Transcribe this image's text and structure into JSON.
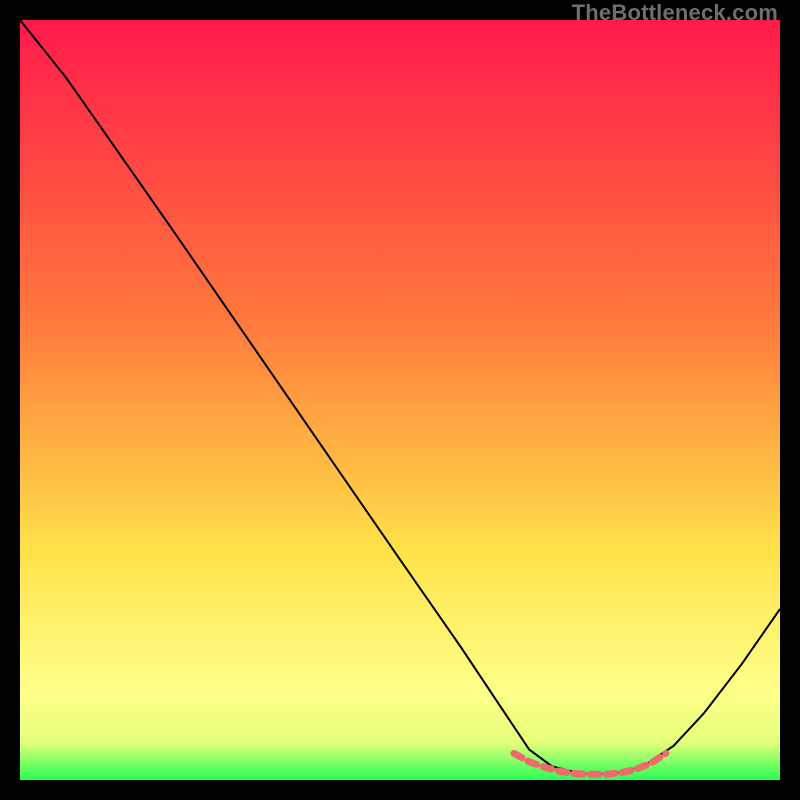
{
  "watermark": "TheBottleneck.com",
  "chart_data": {
    "type": "line",
    "title": "",
    "xlabel": "",
    "ylabel": "",
    "xlim": [
      0,
      100
    ],
    "ylim": [
      0,
      100
    ],
    "grid": false,
    "legend": false,
    "gradient_stops": [
      {
        "offset": 0.0,
        "color": "#ff1a4b"
      },
      {
        "offset": 0.4,
        "color": "#ff7a3c"
      },
      {
        "offset": 0.7,
        "color": "#ffe24a"
      },
      {
        "offset": 0.88,
        "color": "#ffff8a"
      },
      {
        "offset": 0.95,
        "color": "#e6ff7a"
      },
      {
        "offset": 1.0,
        "color": "#28ff55"
      }
    ],
    "series": [
      {
        "name": "curve",
        "stroke": "#000000",
        "stroke_width": 2,
        "points": [
          {
            "x": 0.0,
            "y": 100.0
          },
          {
            "x": 6.0,
            "y": 92.5
          },
          {
            "x": 10.0,
            "y": 86.8
          },
          {
            "x": 20.0,
            "y": 72.5
          },
          {
            "x": 30.0,
            "y": 58.0
          },
          {
            "x": 40.0,
            "y": 43.5
          },
          {
            "x": 50.0,
            "y": 29.0
          },
          {
            "x": 58.0,
            "y": 17.5
          },
          {
            "x": 64.0,
            "y": 8.5
          },
          {
            "x": 67.0,
            "y": 4.0
          },
          {
            "x": 70.0,
            "y": 1.8
          },
          {
            "x": 74.0,
            "y": 0.8
          },
          {
            "x": 78.0,
            "y": 0.8
          },
          {
            "x": 82.0,
            "y": 1.8
          },
          {
            "x": 86.0,
            "y": 4.5
          },
          {
            "x": 90.0,
            "y": 8.8
          },
          {
            "x": 95.0,
            "y": 15.3
          },
          {
            "x": 100.0,
            "y": 22.5
          }
        ]
      },
      {
        "name": "bottom-dash",
        "stroke": "#ef6a6a",
        "stroke_width": 7,
        "dash": "9,7",
        "points": [
          {
            "x": 65.0,
            "y": 3.5
          },
          {
            "x": 67.0,
            "y": 2.4
          },
          {
            "x": 69.0,
            "y": 1.7
          },
          {
            "x": 71.0,
            "y": 1.15
          },
          {
            "x": 73.0,
            "y": 0.85
          },
          {
            "x": 75.0,
            "y": 0.75
          },
          {
            "x": 77.0,
            "y": 0.75
          },
          {
            "x": 79.0,
            "y": 0.95
          },
          {
            "x": 81.0,
            "y": 1.4
          },
          {
            "x": 83.0,
            "y": 2.2
          },
          {
            "x": 85.0,
            "y": 3.5
          }
        ]
      }
    ]
  }
}
